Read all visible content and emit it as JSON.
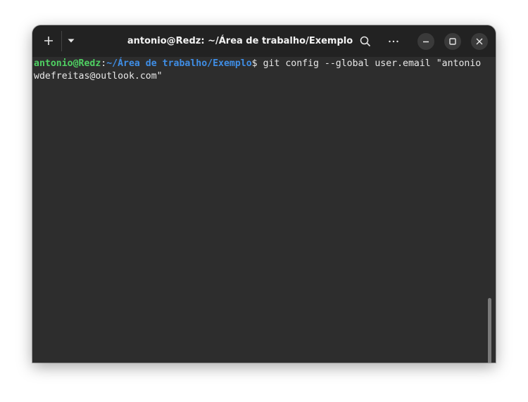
{
  "window": {
    "title": "antonio@Redz: ~/Área de trabalho/Exemplo"
  },
  "titlebar": {
    "icons": {
      "new_tab": "plus-icon",
      "tab_menu": "chevron-down-icon",
      "search": "search-icon",
      "more": "more-horizontal-icon",
      "minimize": "minimize-icon",
      "maximize": "maximize-icon",
      "close": "close-icon"
    }
  },
  "terminal": {
    "prompt_user": "antonio@Redz",
    "prompt_colon": ":",
    "prompt_path": "~/Área de trabalho/Exemplo",
    "prompt_symbol": "$",
    "command_line1": " git config --global user.email \"antonio",
    "command_line2": "wdefreitas@outlook.com\""
  },
  "colors": {
    "background": "#2d2d2d",
    "titlebar": "#222222",
    "prompt_user": "#4fd062",
    "prompt_path": "#3f8ee6",
    "text": "#e8e8e8"
  }
}
